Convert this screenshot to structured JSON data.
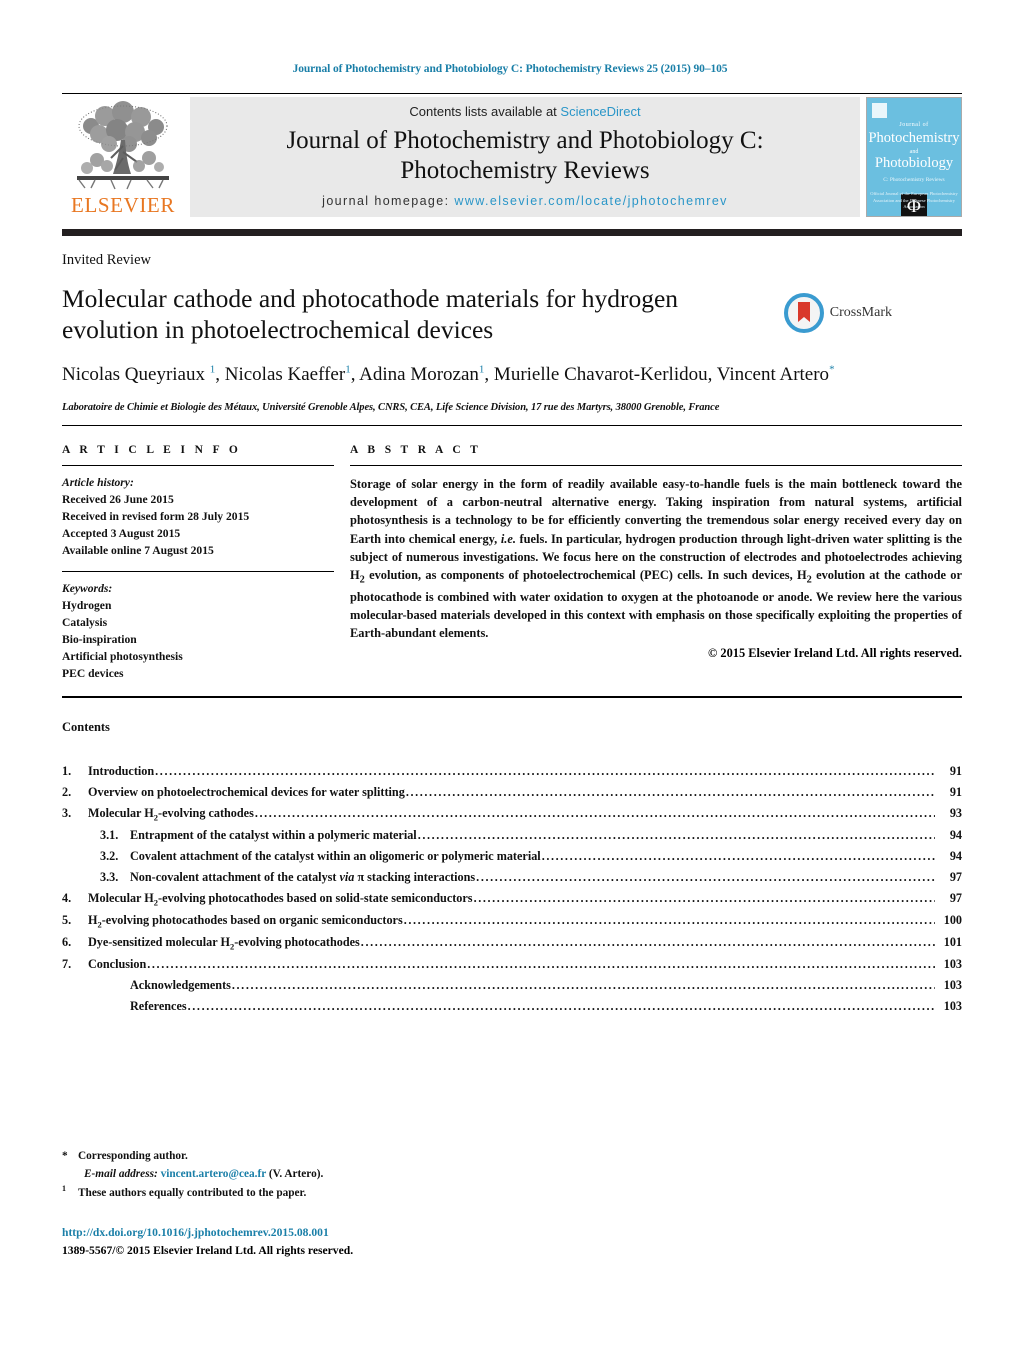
{
  "running_head": "Journal of Photochemistry and Photobiology C: Photochemistry Reviews 25 (2015) 90–105",
  "colors": {
    "link_blue": "#1a7fa8",
    "sciencedirect_blue": "#2a96c8",
    "elsevier_orange": "#E87722",
    "cover_blue": "#6bbfe0",
    "banner_grey": "#e9e9e9"
  },
  "masthead": {
    "publisher": "ELSEVIER",
    "contents_prefix": "Contents lists available at ",
    "contents_link": "ScienceDirect",
    "journal_title_line1": "Journal of Photochemistry and Photobiology C:",
    "journal_title_line2": "Photochemistry Reviews",
    "homepage_prefix": "journal homepage: ",
    "homepage_url": "www.elsevier.com/locate/jphotochemrev",
    "cover": {
      "journal_of": "Journal of",
      "line1": "Photochemistry",
      "and": "and",
      "line2": "Photobiology",
      "subtitle": "C: Photochemistry Reviews",
      "logo_glyph": "Φ",
      "footer": "Official Journal of the European Photochemistry Association and the Japanese Photochemistry Association"
    }
  },
  "article": {
    "doctype": "Invited Review",
    "title": "Molecular cathode and photocathode materials for hydrogen evolution in photoelectrochemical devices",
    "crossmark_label": "CrossMark",
    "authors_html": "Nicolas Queyriaux <sup>1</sup>, Nicolas Kaeffer<sup>1</sup>, Adina Morozan<sup>1</sup>, Murielle Chavarot-Kerlidou, Vincent Artero<sup>*</sup>",
    "authors_plain": "Nicolas Queyriaux 1, Nicolas Kaeffer1, Adina Morozan1, Murielle Chavarot-Kerlidou, Vincent Artero*",
    "affiliation": "Laboratoire de Chimie et Biologie des Métaux, Université Grenoble Alpes, CNRS, CEA, Life Science Division, 17 rue des Martyrs, 38000 Grenoble, France"
  },
  "article_info": {
    "heading": "A R T I C L E   I N F O",
    "history_label": "Article history:",
    "history": [
      "Received 26 June 2015",
      "Received in revised form 28 July 2015",
      "Accepted 3 August 2015",
      "Available online 7 August 2015"
    ],
    "keywords_label": "Keywords:",
    "keywords": [
      "Hydrogen",
      "Catalysis",
      "Bio-inspiration",
      "Artificial photosynthesis",
      "PEC devices"
    ]
  },
  "abstract": {
    "heading": "A B S T R A C T",
    "text_html": "Storage of solar energy in the form of readily available easy-to-handle fuels is the main bottleneck toward the development of a carbon-neutral alternative energy. Taking inspiration from natural systems, artificial photosynthesis is a technology to be for efficiently converting the tremendous solar energy received every day on Earth into chemical energy, <i>i.e.</i> fuels. In particular, hydrogen production through light-driven water splitting is the subject of numerous investigations. We focus here on the construction of electrodes and photoelectrodes achieving H<sub>2</sub> evolution, as components of photoelectrochemical (PEC) cells. In such devices, H<sub>2</sub> evolution at the cathode or photocathode is combined with water oxidation to oxygen at the photoanode or anode. We review here the various molecular-based materials developed in this context with emphasis on those specifically exploiting the properties of Earth-abundant elements.",
    "copyright": "© 2015 Elsevier Ireland Ltd. All rights reserved."
  },
  "contents": {
    "heading": "Contents",
    "entries": [
      {
        "num": "1.",
        "sub": false,
        "label_html": "Introduction",
        "page": "91"
      },
      {
        "num": "2.",
        "sub": false,
        "label_html": "Overview on photoelectrochemical devices for water splitting",
        "page": "91"
      },
      {
        "num": "3.",
        "sub": false,
        "label_html": "Molecular H<sub>2</sub>-evolving cathodes",
        "page": "93"
      },
      {
        "num": "3.1.",
        "sub": true,
        "label_html": "Entrapment of the catalyst within a polymeric material",
        "page": "94"
      },
      {
        "num": "3.2.",
        "sub": true,
        "label_html": "Covalent attachment of the catalyst within an oligomeric or polymeric material",
        "page": "94"
      },
      {
        "num": "3.3.",
        "sub": true,
        "label_html": "Non-covalent attachment of the catalyst <i>via</i> &pi; stacking interactions",
        "page": "97"
      },
      {
        "num": "4.",
        "sub": false,
        "label_html": "Molecular H<sub>2</sub>-evolving photocathodes based on solid-state semiconductors",
        "page": "97"
      },
      {
        "num": "5.",
        "sub": false,
        "label_html": "H<sub>2</sub>-evolving photocathodes based on organic semiconductors",
        "page": "100"
      },
      {
        "num": "6.",
        "sub": false,
        "label_html": "Dye-sensitized molecular H<sub>2</sub>-evolving photocathodes",
        "page": "101"
      },
      {
        "num": "7.",
        "sub": false,
        "label_html": "Conclusion",
        "page": "103"
      },
      {
        "num": "",
        "sub": true,
        "label_html": "Acknowledgements",
        "page": "103",
        "noindent": true
      },
      {
        "num": "",
        "sub": true,
        "label_html": "References",
        "page": "103",
        "noindent": true
      }
    ]
  },
  "footnotes": {
    "corresponding_marker": "*",
    "corresponding_text": "Corresponding author.",
    "email_label": "E-mail address:",
    "email": "vincent.artero@cea.fr",
    "email_suffix": "(V. Artero).",
    "equal_marker": "1",
    "equal_text": "These authors equally contributed to the paper."
  },
  "doi": {
    "url": "http://dx.doi.org/10.1016/j.jphotochemrev.2015.08.001",
    "issn_line": "1389-5567/© 2015 Elsevier Ireland Ltd. All rights reserved."
  }
}
